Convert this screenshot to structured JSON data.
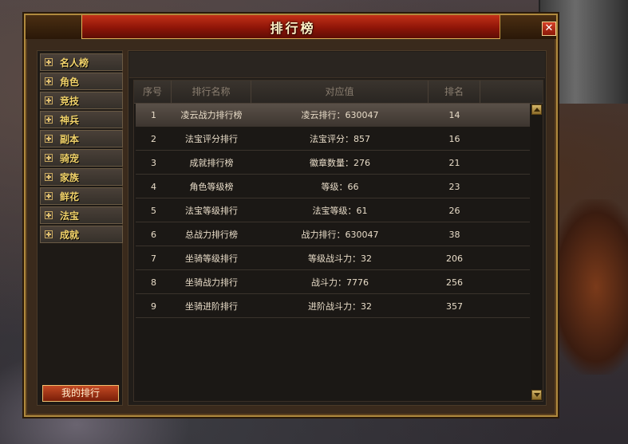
{
  "window": {
    "title": "排行榜",
    "close_label": "✕"
  },
  "sidebar": {
    "items": [
      {
        "label": "名人榜"
      },
      {
        "label": "角色"
      },
      {
        "label": "竞技"
      },
      {
        "label": "神兵"
      },
      {
        "label": "副本"
      },
      {
        "label": "骑宠"
      },
      {
        "label": "家族"
      },
      {
        "label": "鲜花"
      },
      {
        "label": "法宝"
      },
      {
        "label": "成就"
      }
    ],
    "my_rank_label": "我的排行"
  },
  "table": {
    "headers": [
      "序号",
      "排行名称",
      "对应值",
      "排名"
    ],
    "rows": [
      {
        "index": "1",
        "name": "凌云战力排行榜",
        "value": "凌云排行：630047",
        "rank": "14"
      },
      {
        "index": "2",
        "name": "法宝评分排行",
        "value": "法宝评分：857",
        "rank": "16"
      },
      {
        "index": "3",
        "name": "成就排行榜",
        "value": "徽章数量：276",
        "rank": "21"
      },
      {
        "index": "4",
        "name": "角色等级榜",
        "value": "等级：66",
        "rank": "23"
      },
      {
        "index": "5",
        "name": "法宝等级排行",
        "value": "法宝等级：61",
        "rank": "26"
      },
      {
        "index": "6",
        "name": "总战力排行榜",
        "value": "战力排行：630047",
        "rank": "38"
      },
      {
        "index": "7",
        "name": "坐骑等级排行",
        "value": "等级战斗力：32",
        "rank": "206"
      },
      {
        "index": "8",
        "name": "坐骑战力排行",
        "value": "战斗力：7776",
        "rank": "256"
      },
      {
        "index": "9",
        "name": "坐骑进阶排行",
        "value": "进阶战斗力：32",
        "rank": "357"
      }
    ],
    "selected_row": 1
  },
  "colors": {
    "title_red": "#8e1508",
    "gold_text": "#f2d36a",
    "row_text": "#e8dcc8"
  },
  "icons": {
    "expand": "plus-box-icon",
    "scroll_up": "arrow-up-icon",
    "scroll_down": "arrow-down-icon"
  }
}
